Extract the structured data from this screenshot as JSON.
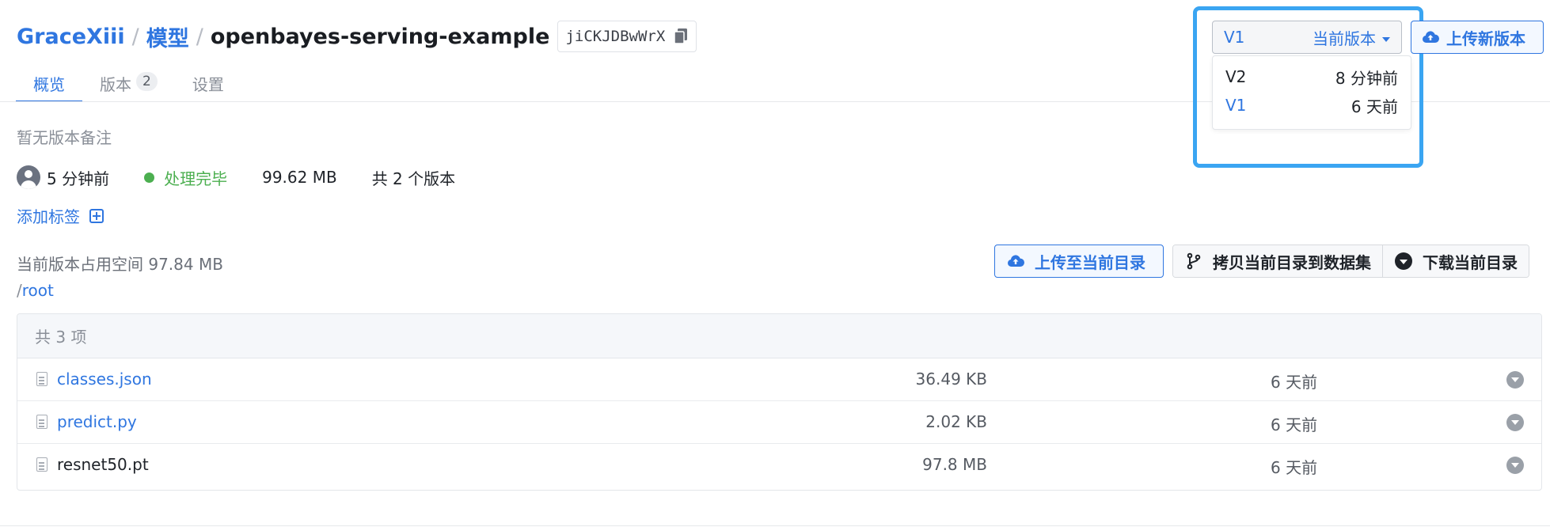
{
  "breadcrumb": {
    "owner": "GraceXiii",
    "separator": "/",
    "section": "模型",
    "repo_name": "openbayes-serving-example",
    "repo_id": "jiCKJDBwWrX"
  },
  "tabs": [
    {
      "label": "概览",
      "active": true
    },
    {
      "label": "版本",
      "badge": "2"
    },
    {
      "label": "设置"
    }
  ],
  "version_selector": {
    "selected": "V1",
    "label": "当前版本",
    "options": [
      {
        "version": "V2",
        "time": "8 分钟前"
      },
      {
        "version": "V1",
        "time": "6 天前",
        "current": true
      }
    ]
  },
  "upload_new_label": "上传新版本",
  "note": "暂无版本备注",
  "meta": {
    "time": "5 分钟前",
    "status": "处理完毕",
    "size": "99.62 MB",
    "versions": "共 2 个版本"
  },
  "add_tag_label": "添加标签",
  "storage_text": "当前版本占用空间 97.84 MB",
  "path": {
    "prefix": "/",
    "dir": "root"
  },
  "actions": {
    "upload_dir": "上传至当前目录",
    "copy_to_dataset": "拷贝当前目录到数据集",
    "download_dir": "下载当前目录"
  },
  "table": {
    "count_label": "共 3 项",
    "files": [
      {
        "name": "classes.json",
        "size": "36.49 KB",
        "time": "6 天前"
      },
      {
        "name": "predict.py",
        "size": "2.02 KB",
        "time": "6 天前"
      },
      {
        "name": "resnet50.pt",
        "size": "97.8 MB",
        "time": "6 天前"
      }
    ]
  },
  "colors": {
    "accent": "#2f76e0",
    "success": "#4caf50",
    "highlight": "#3aa5f2"
  }
}
